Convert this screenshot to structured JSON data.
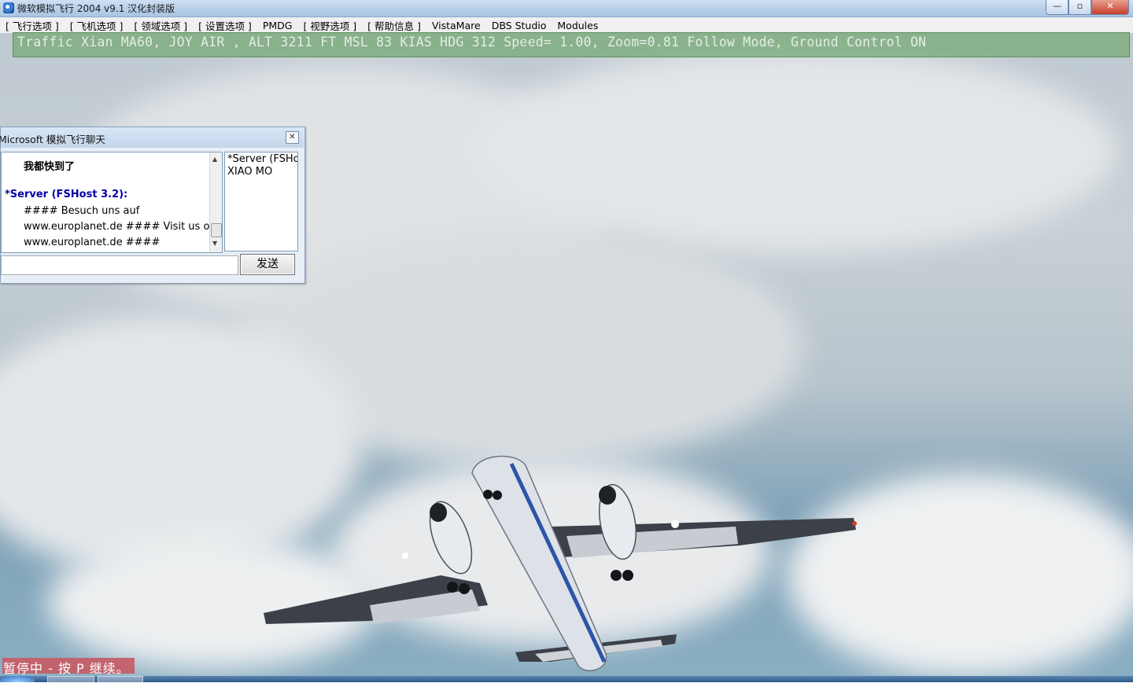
{
  "window": {
    "title": "微软模拟飞行 2004 v9.1 汉化封装版",
    "controls": {
      "minimize": "—",
      "maximize": "▫",
      "close": "✕"
    }
  },
  "menu": [
    "[ 飞行选项 ]",
    "[ 飞机选项 ]",
    "[ 领域选项 ]",
    "[ 设置选项 ]",
    "PMDG",
    "[ 视野选项 ]",
    "[ 帮助信息 ]",
    "VistaMare",
    "DBS Studio",
    "Modules"
  ],
  "hud": {
    "text": "Traffic Xian MA60, JOY AIR , ALT 3211 FT MSL  83 KIAS  HDG 312 Speed= 1.00, Zoom=0.81 Follow Mode, Ground Control ON"
  },
  "chat": {
    "title": "Microsoft 模拟飞行聊天",
    "close": "✕",
    "messages": [
      "我都快到了",
      "*Server (FSHost 3.2):",
      "#### Besuch uns auf",
      "www.europlanet.de #### Visit us on",
      "www.europlanet.de ####"
    ],
    "users": [
      "*Server (FSHost",
      "XIAO MO"
    ],
    "input_value": "",
    "send_label": "发送",
    "scroll_up": "▲",
    "scroll_down": "▼"
  },
  "status": {
    "pause_text": "暂停中 - 按 P 继续。"
  },
  "colors": {
    "hud_bg": "#78aa78",
    "server_text": "#0000a8",
    "pause_bg": "#c85a64"
  }
}
